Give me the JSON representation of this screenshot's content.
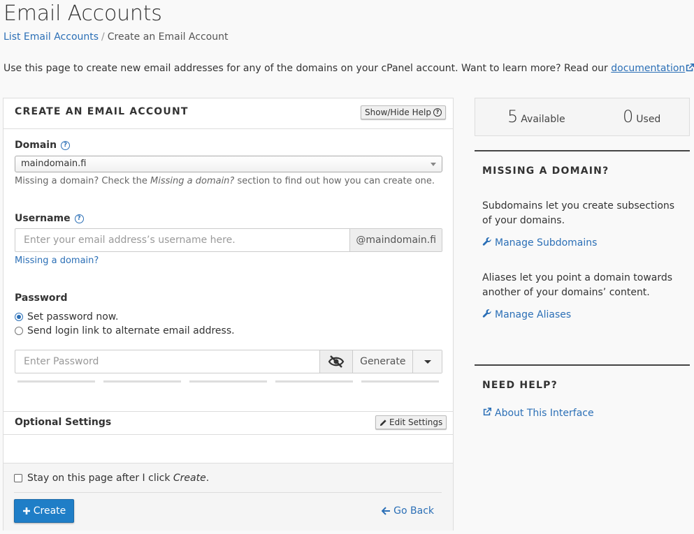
{
  "page": {
    "title": "Email Accounts",
    "breadcrumb": {
      "link": "List Email Accounts",
      "separator": "/",
      "current": "Create an Email Account"
    },
    "intro": {
      "text": "Use this page to create new email addresses for any of the domains on your cPanel account. Want to learn more? Read our ",
      "link": "documentation",
      "end": "."
    }
  },
  "form": {
    "header": "CREATE AN EMAIL ACCOUNT",
    "show_hide_help": "Show/Hide Help",
    "domain": {
      "label": "Domain",
      "value": "maindomain.fi",
      "hint_prefix": "Missing a domain? Check the ",
      "hint_em": "Missing a domain?",
      "hint_suffix": " section to find out how you can create one."
    },
    "username": {
      "label": "Username",
      "placeholder": "Enter your email address’s username here.",
      "suffix": "@maindomain.fi",
      "missing_link": "Missing a domain?"
    },
    "password": {
      "label": "Password",
      "options": [
        "Set password now.",
        "Send login link to alternate email address."
      ],
      "selected": 0,
      "placeholder": "Enter Password",
      "generate": "Generate"
    },
    "optional": {
      "label": "Optional Settings",
      "edit": "Edit Settings"
    },
    "stay": {
      "prefix": "Stay on this page after I click ",
      "em": "Create",
      "suffix": "."
    },
    "create": "Create",
    "go_back": "Go Back"
  },
  "sidebar": {
    "available": {
      "count": "5",
      "label": "Available"
    },
    "used": {
      "count": "0",
      "label": "Used"
    },
    "missing": {
      "title": "MISSING A DOMAIN?",
      "subdomains_text": "Subdomains let you create subsections of your domains.",
      "subdomains_link": "Manage Subdomains",
      "aliases_text": "Aliases let you point a domain towards another of your domains’ content.",
      "aliases_link": "Manage Aliases"
    },
    "help": {
      "title": "NEED HELP?",
      "link": "About This Interface"
    }
  },
  "colors": {
    "accent": "#2b6fb6",
    "primary_button": "#1f7ec7"
  }
}
